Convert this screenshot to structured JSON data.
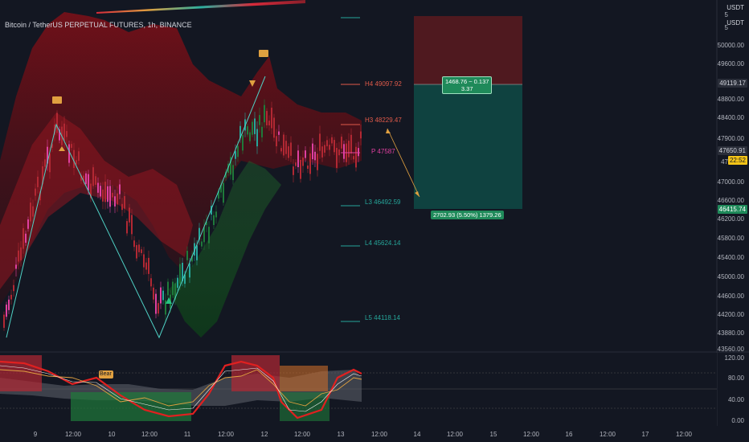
{
  "chart": {
    "title": "Bitcoin / TetherUS PERPETUAL FUTURES, 1h, BINANCE",
    "currency_top": "USDT",
    "currency_mid": "USDT",
    "top_partial_left": "5",
    "top_partial_mid": "5",
    "price_axis": [
      "50000.00",
      "49600.00",
      "48800.00",
      "48400.00",
      "47900.00",
      "47",
      "47000.00",
      "46600.00",
      "46200.00",
      "45800.00",
      "45400.00",
      "45000.00",
      "44600.00",
      "44200.00",
      "43880.00",
      "43560.00"
    ],
    "indicator_axis": [
      "120.00",
      "80.00",
      "40.00",
      "0.00"
    ],
    "time_axis": [
      "9",
      "12:00",
      "10",
      "12:00",
      "11",
      "12:00",
      "12",
      "12:00",
      "13",
      "12:00",
      "14",
      "12:00",
      "15",
      "12:00",
      "16",
      "12:00",
      "17",
      "12:00"
    ],
    "pivots": {
      "h3": "H3 48229.47",
      "h4": "H4 49097.92",
      "p": "P 47587",
      "l3": "L3 46492.59",
      "l4": "L4 45624.14",
      "l5": "L5 44118.14"
    },
    "price_tags": {
      "upper": "49119.17",
      "current": "47650.91",
      "countdown": "22:52",
      "lower": "46415.74"
    },
    "position_tool": {
      "target_label_line1": "1468.76 ~ 0.137",
      "target_label_line2": "3.37",
      "stop_label": "2702.93 (5.50%) 1379.26"
    },
    "indicator_label": "Bear",
    "colors": {
      "background": "#131722",
      "bear": "#b22833",
      "bull": "#1f7a3a",
      "teal": "#26a69a",
      "magenta": "#e040a0",
      "yellow": "#f5c518",
      "gold": "#e0a040"
    }
  }
}
